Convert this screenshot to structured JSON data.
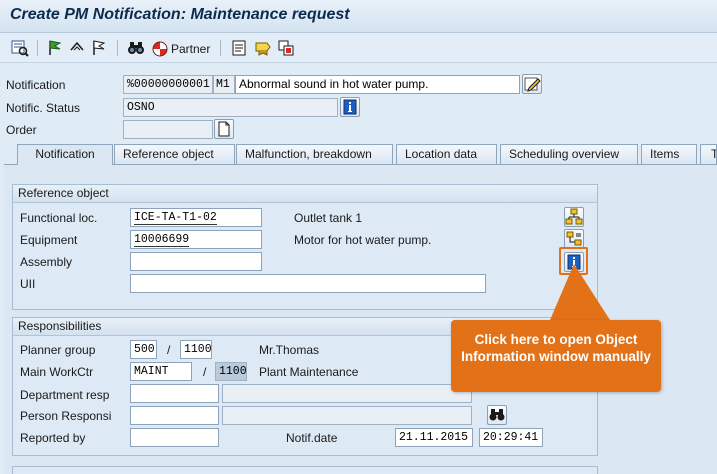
{
  "title": "Create PM Notification: Maintenance request",
  "toolbar": {
    "partner_label": "Partner",
    "icons": [
      "overview-icon",
      "flag-icon",
      "link-icon",
      "flag-outline-icon",
      "binoculars-icon",
      "partner-icon",
      "notes-icon",
      "catalog-icon",
      "structure-icon"
    ]
  },
  "header": {
    "notification_label": "Notification",
    "notification_number": "%00000000001",
    "notification_type": "M1",
    "notification_text": "Abnormal sound in hot water pump.",
    "status_label": "Notific. Status",
    "status_value": "OSNO",
    "order_label": "Order",
    "order_value": ""
  },
  "tabs": [
    "Notification",
    "Reference object",
    "Malfunction, breakdown",
    "Location data",
    "Scheduling overview",
    "Items",
    "T"
  ],
  "active_tab": "Notification",
  "reference_object": {
    "title": "Reference object",
    "functional_loc_label": "Functional loc.",
    "functional_loc_value": "ICE-TA-T1-02",
    "functional_loc_desc": "Outlet tank 1",
    "equipment_label": "Equipment",
    "equipment_value": "10006699",
    "equipment_desc": "Motor for hot water pump.",
    "assembly_label": "Assembly",
    "assembly_value": "",
    "uii_label": "UII",
    "uii_value": ""
  },
  "responsibilities": {
    "title": "Responsibilities",
    "planner_group_label": "Planner group",
    "planner_group_value": "500",
    "planner_group_plant": "1100",
    "planner_group_desc": "Mr.Thomas",
    "main_workctr_label": "Main WorkCtr",
    "main_workctr_value": "MAINT",
    "main_workctr_plant": "1100",
    "main_workctr_desc": "Plant Maintenance",
    "slash": "/",
    "department_label": "Department resp",
    "person_label": "Person Responsi",
    "reported_by_label": "Reported by",
    "reported_by_value": "",
    "notif_date_label": "Notif.date",
    "notif_date_value": "21.11.2015",
    "notif_time_value": "20:29:41"
  },
  "callout": {
    "text": "Click here to open Object Information window manually"
  },
  "colors": {
    "callout": "#e37118",
    "title": "#0d2b4d",
    "info_button": "#1f5fbf",
    "background": "#dfebf5"
  }
}
